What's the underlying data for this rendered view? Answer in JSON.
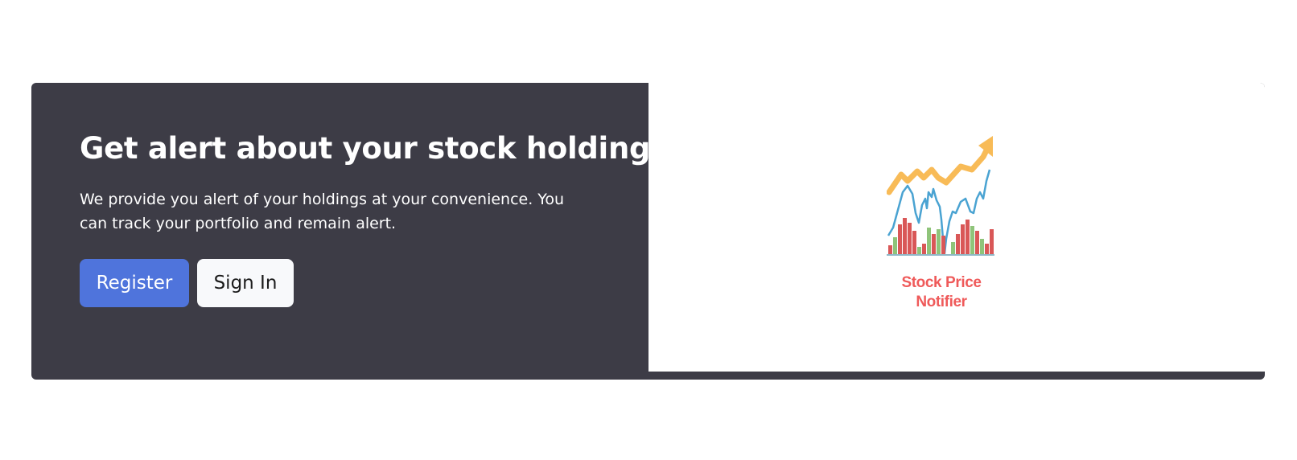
{
  "hero": {
    "title": "Get alert about your stock holding",
    "description": "We provide you alert of your holdings at your convenience. You can track your portfolio and remain alert.",
    "register_label": "Register",
    "signin_label": "Sign In"
  },
  "logo": {
    "caption_line1": "Stock Price",
    "caption_line2": "Notifier",
    "icon": "stock-chart-logo-icon"
  },
  "colors": {
    "hero_bg": "#3d3c46",
    "primary": "#4f74dc",
    "light_button": "#f8f9fb",
    "logo_text": "#ef5a5a",
    "arrow": "#f8bb57",
    "line": "#4aa3d2",
    "bar_red": "#d95757",
    "bar_green": "#8fc47a"
  }
}
